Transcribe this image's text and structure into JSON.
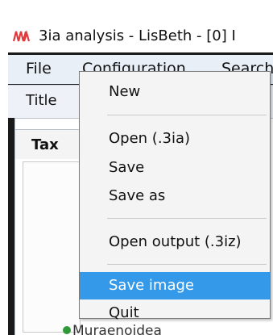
{
  "window": {
    "title": "3ia analysis - LisBeth - [0] I"
  },
  "menubar": {
    "items": [
      "File",
      "Configuration",
      "Search"
    ]
  },
  "toolbar": {
    "title_label": "Title"
  },
  "panel": {
    "tab_label": "Tax",
    "tree_item": "Muraenoidea"
  },
  "dropdown": {
    "items": [
      {
        "label": "New"
      },
      {
        "label": "Open (.3ia)"
      },
      {
        "label": "Save"
      },
      {
        "label": "Save as"
      },
      {
        "label": "Open output (.3iz)"
      },
      {
        "label": "Save image",
        "highlighted": true
      },
      {
        "label": "Quit"
      }
    ]
  },
  "colors": {
    "highlight": "#3399e8",
    "menubar": "#e8eff7",
    "accent_icon": "#e03a3a"
  }
}
